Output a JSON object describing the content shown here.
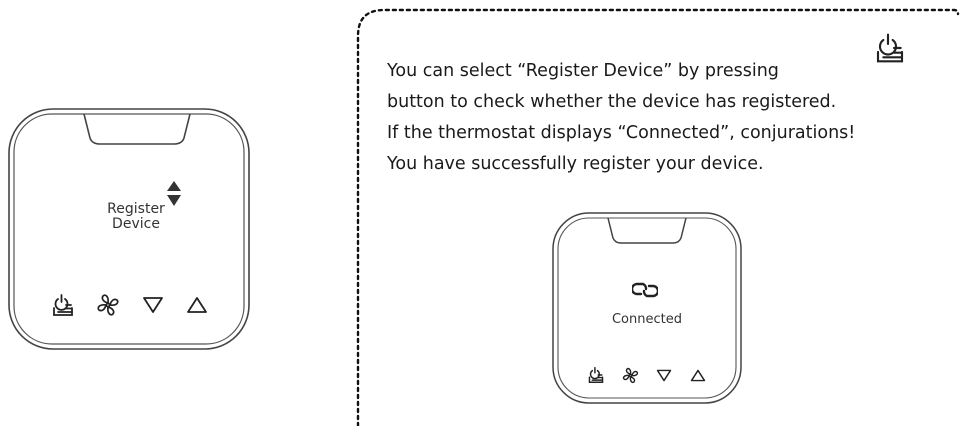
{
  "left_device": {
    "display_text_line1": "Register",
    "display_text_line2": "Device",
    "indicator_icon": "up-down-triangles-icon",
    "buttons": [
      "power-menu-icon",
      "fan-icon",
      "down-arrow-icon",
      "up-arrow-icon"
    ]
  },
  "callout": {
    "line1": "You can select “Register Device” by pressing",
    "line2": "button to check whether the device has registered.",
    "line3": "If the thermostat displays “Connected”, conjurations!",
    "line4": "You have successfully register your device.",
    "inline_icon": "power-menu-icon",
    "border_style": "dotted"
  },
  "right_device": {
    "status_text": "Connected",
    "status_icon": "link-icon",
    "buttons": [
      "power-menu-icon",
      "fan-icon",
      "down-arrow-icon",
      "up-arrow-icon"
    ]
  },
  "colors": {
    "outline": "#555555",
    "text": "#1a1a1a",
    "accent_dark": "#333333"
  }
}
